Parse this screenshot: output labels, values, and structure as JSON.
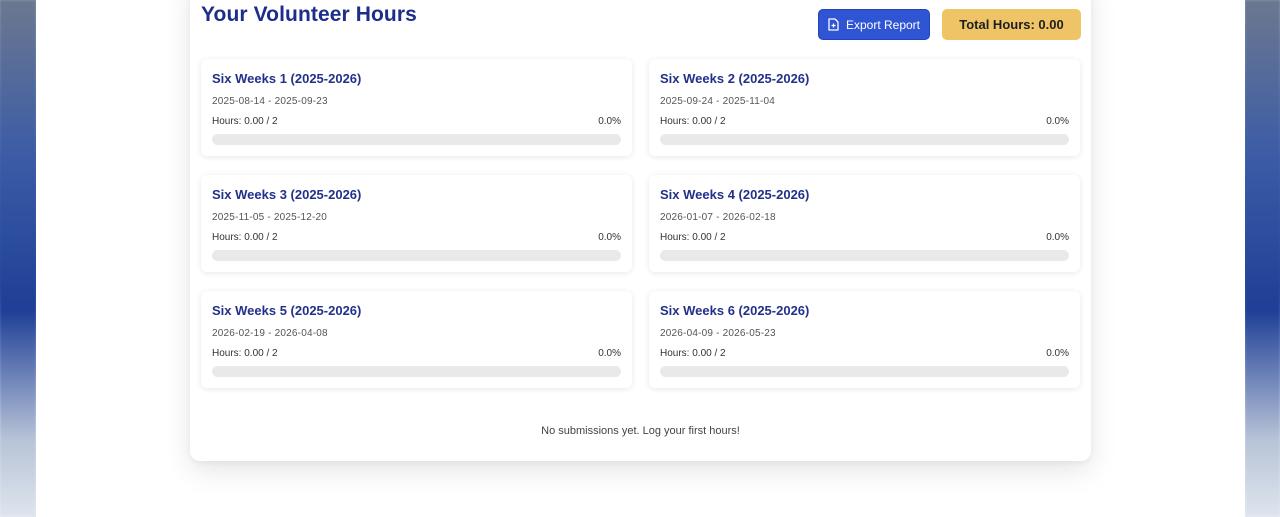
{
  "header": {
    "title": "Your Volunteer Hours",
    "export_label": "Export Report",
    "total_hours_label": "Total Hours: 0.00"
  },
  "periods": [
    {
      "title": "Six Weeks 1 (2025-2026)",
      "dates": "2025-08-14 - 2025-09-23",
      "hours": "Hours: 0.00 / 2",
      "percent": "0.0%",
      "progress": 0
    },
    {
      "title": "Six Weeks 2 (2025-2026)",
      "dates": "2025-09-24 - 2025-11-04",
      "hours": "Hours: 0.00 / 2",
      "percent": "0.0%",
      "progress": 0
    },
    {
      "title": "Six Weeks 3 (2025-2026)",
      "dates": "2025-11-05 - 2025-12-20",
      "hours": "Hours: 0.00 / 2",
      "percent": "0.0%",
      "progress": 0
    },
    {
      "title": "Six Weeks 4 (2025-2026)",
      "dates": "2026-01-07 - 2026-02-18",
      "hours": "Hours: 0.00 / 2",
      "percent": "0.0%",
      "progress": 0
    },
    {
      "title": "Six Weeks 5 (2025-2026)",
      "dates": "2026-02-19 - 2026-04-08",
      "hours": "Hours: 0.00 / 2",
      "percent": "0.0%",
      "progress": 0
    },
    {
      "title": "Six Weeks 6 (2025-2026)",
      "dates": "2026-04-09 - 2026-05-23",
      "hours": "Hours: 0.00 / 2",
      "percent": "0.0%",
      "progress": 0
    }
  ],
  "empty_message": "No submissions yet. Log your first hours!",
  "icons": {
    "export": "document-export-icon"
  },
  "colors": {
    "title": "#1d2d8a",
    "export_button": "#2f55d4",
    "total_badge": "#eec467",
    "progress_track": "#e9e9e9"
  }
}
